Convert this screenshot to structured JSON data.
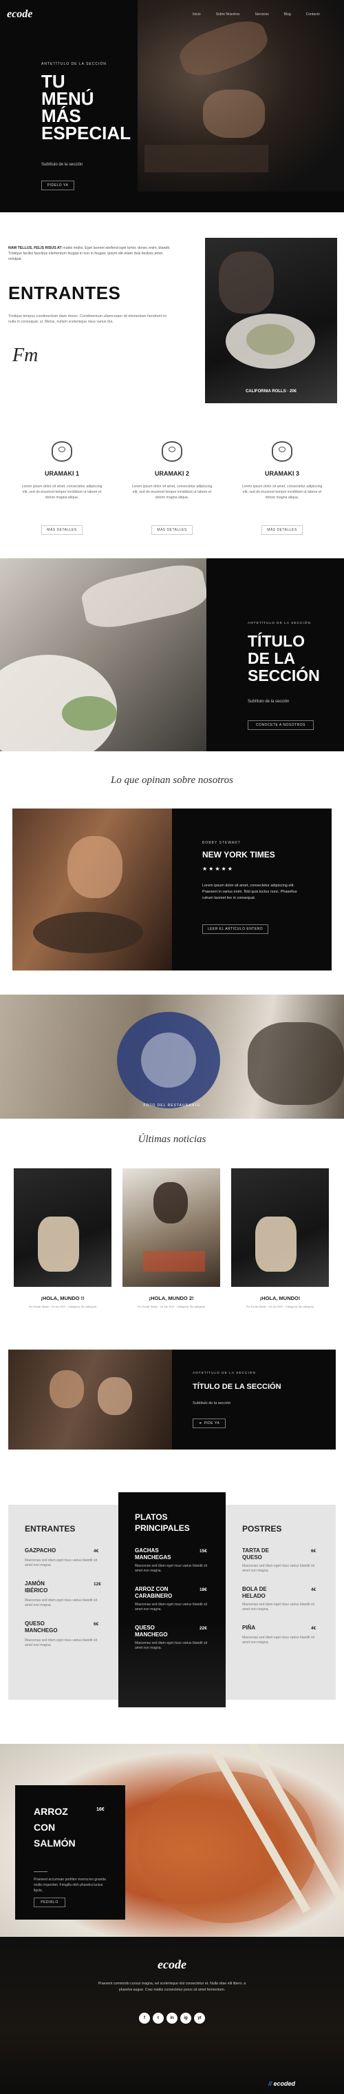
{
  "nav": {
    "logo": "ecode",
    "items": [
      "Inicio",
      "Sobre Nosotros",
      "Servicios",
      "Blog",
      "Contacto"
    ]
  },
  "hero": {
    "eyebrow": "ANTETÍTULO DE LA SECCIÓN",
    "title_lines": [
      "TU",
      "MENÚ",
      "MÁS",
      "ESPECIAL"
    ],
    "subtitle": "Subtítulo de la sección",
    "button": "PIDELO YA"
  },
  "entrantes": {
    "lead_bold": "NAM TELLUS, FELIS RISUS AT",
    "lead_rest": " mattis mollis. Eget laoreet eleifend eget tortor, donec enim, blandit. Tristique facilisi faucibus elementum feugiat in non in feugiat. Ipsum elit etiam duis facilisis amet volutpat.",
    "title": "ENTRANTES",
    "body": "Tristique tempus condimentum diam donec. Condimentum ullamcorper sit elementum hendrerit mi nulla in consequat, ut. Metus, nullam scelerisque risus varius dui.",
    "signature": "Fm",
    "photo_caption": "CALIFORNIA ROLLS · 20€"
  },
  "features": [
    {
      "title": "URAMAKI 1",
      "text": "Lorem ipsum dolor sit amet, consectetur adipiscing elit, sed do eiusmod tempor incididunt ut labore et dolore magna aliqua.",
      "button": "MÁS DETALLES"
    },
    {
      "title": "URAMAKI 2",
      "text": "Lorem ipsum dolor sit amet, consectetur adipiscing elit, sed do eiusmod tempor incididunt ut labore et dolore magna aliqua.",
      "button": "MÁS DETALLES"
    },
    {
      "title": "URAMAKI 3",
      "text": "Lorem ipsum dolor sit amet, consectetur adipiscing elit, sed do eiusmod tempor incididunt ut labore et dolore magna aliqua.",
      "button": "MÁS DETALLES"
    }
  ],
  "section2": {
    "eyebrow": "ANTETÍTULO DE LA SECCIÓN",
    "title_lines": [
      "TÍTULO",
      "DE LA",
      "SECCIÓN"
    ],
    "subtitle": "Subtítulo de la sección",
    "button": "CONOCETE A NOSOTROS"
  },
  "testimonials": {
    "heading": "Lo que opinan sobre nosotros",
    "author": "BOBBY STEWART",
    "source": "NEW YORK TIMES",
    "stars": "★★★★★",
    "quote": "Lorem ipsum dolor sit amet, consectetur adipiscing elit. Praesent in varius enim. Nisl quis luctus nunc. Phasellus rutrum laoreet leo in consequat.",
    "button": "LEER EL ARTÍCULO ENTERO"
  },
  "banner": {
    "caption": "FOTO DEL RESTAURANTE"
  },
  "news": {
    "heading": "Últimas noticias",
    "posts": [
      {
        "title": "¡HOLA, MUNDO !!",
        "meta": "Por Ecode Studio · 18 Jun 2021 · Categoría: Sin categoría"
      },
      {
        "title": "¡HOLA, MUNDO 2!",
        "meta": "Por Ecode Studio · 18 Jun 2021 · Categoría: Sin categoría"
      },
      {
        "title": "¡HOLA, MUNDO!",
        "meta": "Por Ecode Studio · 18 Jun 2021 · Categoría: Sin categoría"
      }
    ]
  },
  "cta": {
    "eyebrow": "ANTETÍTULO DE LA SECCIÓN",
    "title": "TÍTULO DE LA SECCIÓN",
    "subtitle": "Subtítulo de la sección",
    "button": "PIDE YA"
  },
  "menu": {
    "col1": {
      "title": "ENTRANTES",
      "items": [
        {
          "name_lines": [
            "GAZPACHO"
          ],
          "price": "4€",
          "desc": "Maecenas sed diam eget risus varius blandit sit amet non magna."
        },
        {
          "name_lines": [
            "JAMÓN",
            "IBÉRICO"
          ],
          "price": "12€",
          "desc": "Maecenas sed diam eget risus varius blandit sit amet non magna."
        },
        {
          "name_lines": [
            "QUESO",
            "MANCHEGO"
          ],
          "price": "6€",
          "desc": "Maecenas sed diam eget risus varius blandit sit amet non magna."
        }
      ]
    },
    "col2": {
      "title_lines": [
        "PLATOS",
        "PRINCIPALES"
      ],
      "items": [
        {
          "name_lines": [
            "GACHAS",
            "MANCHEGAS"
          ],
          "price": "15€",
          "desc": "Maecenas sed diam eget risus varius blandit sit amet non magna."
        },
        {
          "name_lines": [
            "ARROZ CON",
            "CARABINERO"
          ],
          "price": "18€",
          "desc": "Maecenas sed diam eget risus varius blandit sit amet non magna."
        },
        {
          "name_lines": [
            "QUESO",
            "MANCHEGO"
          ],
          "price": "22€",
          "desc": "Maecenas sed diam eget risus varius blandit sit amet non magna."
        }
      ]
    },
    "col3": {
      "title": "POSTRES",
      "items": [
        {
          "name_lines": [
            "TARTA DE",
            "QUESO"
          ],
          "price": "6€",
          "desc": "Maecenas sed diam eget risus varius blandit sit amet non magna."
        },
        {
          "name_lines": [
            "BOLA DE",
            "HELADO"
          ],
          "price": "4€",
          "desc": "Maecenas sed diam eget risus varius blandit sit amet non magna."
        },
        {
          "name_lines": [
            "PIÑA"
          ],
          "price": "4€",
          "desc": "Maecenas sed diam eget risus varius blandit sit amet non magna."
        }
      ]
    }
  },
  "special": {
    "title_lines": [
      "ARROZ",
      "CON",
      "SALMÓN"
    ],
    "price": "16€",
    "text": "Praesent accumsan porttitor viverra leo gravida mollis imperdiet. Fringilla nibh pharetra luctus ligula.",
    "button": "PEDIRLO"
  },
  "footer": {
    "logo": "ecode",
    "text": "Praesent commodo cursus magna, vel scelerisque nisl consectetur et. Nulla vitae elit libero, a pharetra augue. Cras mattis consectetur purus sit amet fermentum.",
    "social": [
      "f",
      "t",
      "in",
      "ig",
      "yt"
    ],
    "credit": "ecoded"
  },
  "colors": {
    "dark": "#0a0a0a",
    "panel": "#e5e5e5",
    "accent": "#ffffff"
  }
}
